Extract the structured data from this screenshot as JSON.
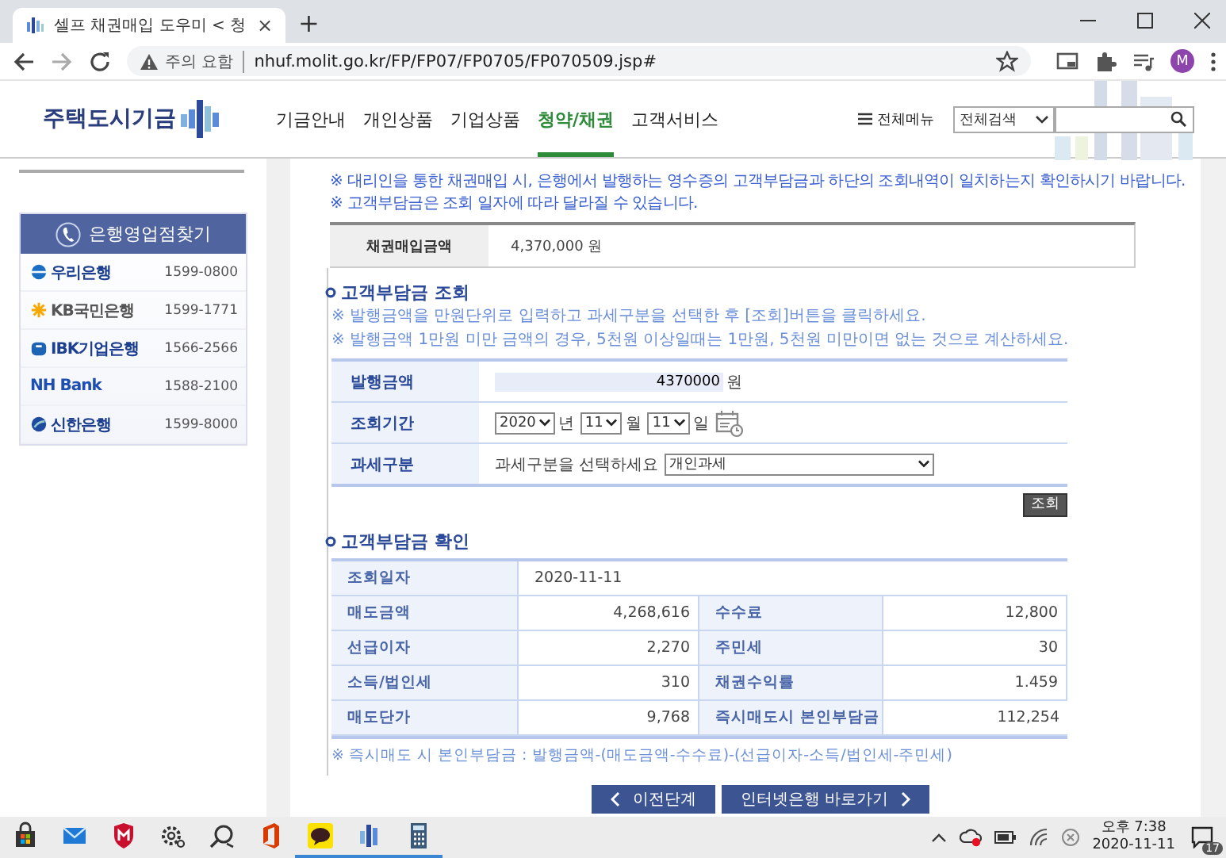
{
  "browser": {
    "tab": {
      "title": "셀프 채권매입 도우미 < 청",
      "close": "×"
    },
    "new_tab": "+",
    "address": {
      "warning": "주의 요함",
      "url": "nhuf.molit.go.kr/FP/FP07/FP0705/FP070509.jsp#"
    },
    "profile": "M"
  },
  "site_header": {
    "logo": "주택도시기금",
    "nav": [
      {
        "label": "기금안내",
        "selected": false
      },
      {
        "label": "개인상품",
        "selected": false
      },
      {
        "label": "기업상품",
        "selected": false
      },
      {
        "label": "청약/채권",
        "selected": true
      },
      {
        "label": "고객서비스",
        "selected": false
      }
    ],
    "all_menu": "전체메뉴",
    "search_scope": "전체검색"
  },
  "sidebar": {
    "title": "은행영업점찾기",
    "banks": [
      {
        "kind": "woori",
        "name": "우리은행",
        "phone": "1599-0800"
      },
      {
        "kind": "kb",
        "name": "KB국민은행",
        "phone": "1599-1771"
      },
      {
        "kind": "ibk",
        "name": "IBK기업은행",
        "phone": "1566-2566"
      },
      {
        "kind": "nh",
        "name": "NH Bank",
        "phone": "1588-2100"
      },
      {
        "kind": "shinhan",
        "name": "신한은행",
        "phone": "1599-8000"
      }
    ]
  },
  "notices": [
    "※ 대리인을 통한 채권매입 시, 은행에서 발행하는 영수증의 고객부담금과 하단의 조회내역이 일치하는지 확인하시기 바랍니다.",
    "※ 고객부담금은 조회 일자에 따라 달라질 수 있습니다."
  ],
  "purchase": {
    "label": "채권매입금액",
    "value": "4,370,000 원"
  },
  "inquiry": {
    "title": "고객부담금 조회",
    "notes": [
      "※ 발행금액을 만원단위로 입력하고 과세구분을 선택한 후 [조회]버튼을 클릭하세요.",
      "※ 발행금액 1만원 미만 금액의 경우, 5천원 이상일때는 1만원, 5천원 미만이면 없는 것으로 계산하세요."
    ],
    "amount": {
      "label": "발행금액",
      "value": "4370000",
      "unit": "원"
    },
    "period": {
      "label": "조회기간",
      "year": "2020",
      "year_unit": "년",
      "month": "11",
      "month_unit": "월",
      "day": "11",
      "day_unit": "일"
    },
    "tax": {
      "label": "과세구분",
      "prompt": "과세구분을 선택하세요",
      "value": "개인과세"
    },
    "button": "조회"
  },
  "result": {
    "title": "고객부담금 확인",
    "date": {
      "label": "조회일자",
      "value": "2020-11-11"
    },
    "rows": [
      [
        {
          "label": "매도금액",
          "value": "4,268,616"
        },
        {
          "label": "수수료",
          "value": "12,800"
        }
      ],
      [
        {
          "label": "선급이자",
          "value": "2,270"
        },
        {
          "label": "주민세",
          "value": "30"
        }
      ],
      [
        {
          "label": "소득/법인세",
          "value": "310"
        },
        {
          "label": "채권수익률",
          "value": "1.459"
        }
      ],
      [
        {
          "label": "매도단가",
          "value": "9,768"
        },
        {
          "label": "즉시매도시 본인부담금",
          "value": "112,254"
        }
      ]
    ],
    "footnote": "※ 즉시매도 시 본인부담금 : 발행금액-(매도금액-수수료)-(선급이자-소득/법인세-주민세)"
  },
  "buttons": [
    {
      "kind": "prev",
      "label": "이전단계"
    },
    {
      "kind": "next",
      "label": "인터넷은행 바로가기"
    }
  ],
  "taskbar": {
    "apps": [
      {
        "kind": "store",
        "running": false
      },
      {
        "kind": "mail",
        "running": false
      },
      {
        "kind": "shield",
        "running": false
      },
      {
        "kind": "gear",
        "running": false
      },
      {
        "kind": "search",
        "running": false
      },
      {
        "kind": "office",
        "running": false
      },
      {
        "kind": "chat",
        "running": true
      },
      {
        "kind": "site",
        "running": true
      },
      {
        "kind": "calculator",
        "running": true
      }
    ],
    "time": "오후 7:38",
    "date": "2020-11-11",
    "notifications": "17"
  }
}
